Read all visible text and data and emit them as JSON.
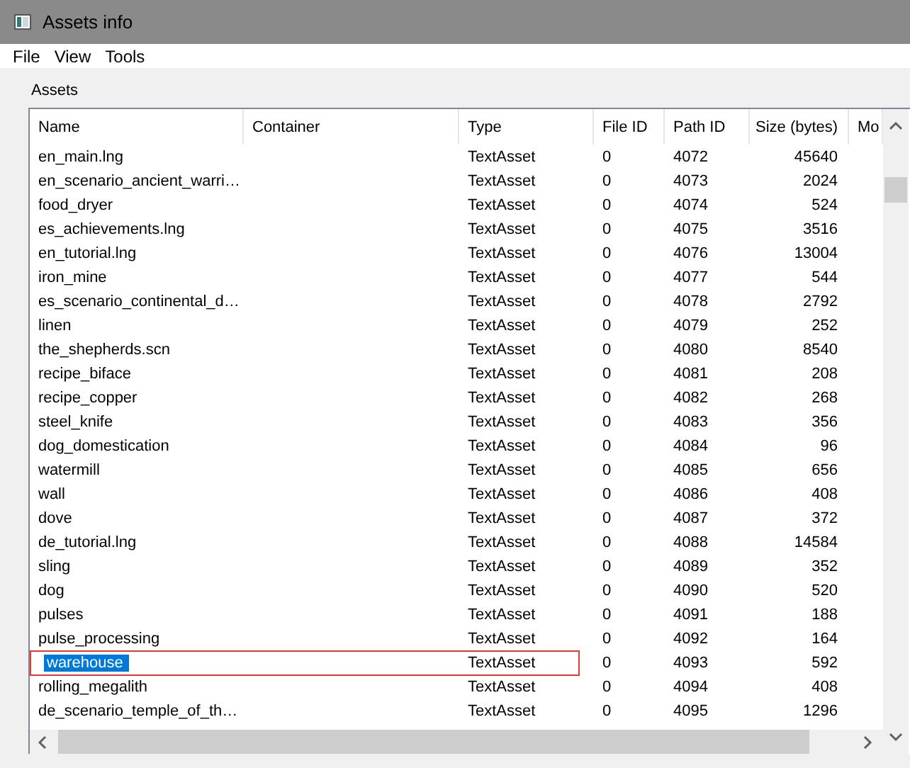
{
  "window": {
    "title": "Assets info"
  },
  "menu": [
    "File",
    "View",
    "Tools"
  ],
  "group_label": "Assets",
  "table": {
    "columns": [
      "Name",
      "Container",
      "Type",
      "File ID",
      "Path ID",
      "Size (bytes)",
      "Mo"
    ],
    "rows": [
      {
        "name": "en_main.lng",
        "type": "TextAsset",
        "file_id": "0",
        "path_id": "4072",
        "size": "45640",
        "selected": false,
        "outlined": false
      },
      {
        "name": "en_scenario_ancient_warri…",
        "type": "TextAsset",
        "file_id": "0",
        "path_id": "4073",
        "size": "2024",
        "selected": false,
        "outlined": false
      },
      {
        "name": "food_dryer",
        "type": "TextAsset",
        "file_id": "0",
        "path_id": "4074",
        "size": "524",
        "selected": false,
        "outlined": false
      },
      {
        "name": "es_achievements.lng",
        "type": "TextAsset",
        "file_id": "0",
        "path_id": "4075",
        "size": "3516",
        "selected": false,
        "outlined": false
      },
      {
        "name": "en_tutorial.lng",
        "type": "TextAsset",
        "file_id": "0",
        "path_id": "4076",
        "size": "13004",
        "selected": false,
        "outlined": false
      },
      {
        "name": "iron_mine",
        "type": "TextAsset",
        "file_id": "0",
        "path_id": "4077",
        "size": "544",
        "selected": false,
        "outlined": false
      },
      {
        "name": "es_scenario_continental_d…",
        "type": "TextAsset",
        "file_id": "0",
        "path_id": "4078",
        "size": "2792",
        "selected": false,
        "outlined": false
      },
      {
        "name": "linen",
        "type": "TextAsset",
        "file_id": "0",
        "path_id": "4079",
        "size": "252",
        "selected": false,
        "outlined": false
      },
      {
        "name": "the_shepherds.scn",
        "type": "TextAsset",
        "file_id": "0",
        "path_id": "4080",
        "size": "8540",
        "selected": false,
        "outlined": false
      },
      {
        "name": "recipe_biface",
        "type": "TextAsset",
        "file_id": "0",
        "path_id": "4081",
        "size": "208",
        "selected": false,
        "outlined": false
      },
      {
        "name": "recipe_copper",
        "type": "TextAsset",
        "file_id": "0",
        "path_id": "4082",
        "size": "268",
        "selected": false,
        "outlined": false
      },
      {
        "name": "steel_knife",
        "type": "TextAsset",
        "file_id": "0",
        "path_id": "4083",
        "size": "356",
        "selected": false,
        "outlined": false
      },
      {
        "name": "dog_domestication",
        "type": "TextAsset",
        "file_id": "0",
        "path_id": "4084",
        "size": "96",
        "selected": false,
        "outlined": false
      },
      {
        "name": "watermill",
        "type": "TextAsset",
        "file_id": "0",
        "path_id": "4085",
        "size": "656",
        "selected": false,
        "outlined": false
      },
      {
        "name": "wall",
        "type": "TextAsset",
        "file_id": "0",
        "path_id": "4086",
        "size": "408",
        "selected": false,
        "outlined": false
      },
      {
        "name": "dove",
        "type": "TextAsset",
        "file_id": "0",
        "path_id": "4087",
        "size": "372",
        "selected": false,
        "outlined": false
      },
      {
        "name": "de_tutorial.lng",
        "type": "TextAsset",
        "file_id": "0",
        "path_id": "4088",
        "size": "14584",
        "selected": false,
        "outlined": false
      },
      {
        "name": "sling",
        "type": "TextAsset",
        "file_id": "0",
        "path_id": "4089",
        "size": "352",
        "selected": false,
        "outlined": false
      },
      {
        "name": "dog",
        "type": "TextAsset",
        "file_id": "0",
        "path_id": "4090",
        "size": "520",
        "selected": false,
        "outlined": false
      },
      {
        "name": "pulses",
        "type": "TextAsset",
        "file_id": "0",
        "path_id": "4091",
        "size": "188",
        "selected": false,
        "outlined": false
      },
      {
        "name": "pulse_processing",
        "type": "TextAsset",
        "file_id": "0",
        "path_id": "4092",
        "size": "164",
        "selected": false,
        "outlined": false
      },
      {
        "name": "warehouse",
        "type": "TextAsset",
        "file_id": "0",
        "path_id": "4093",
        "size": "592",
        "selected": true,
        "outlined": true
      },
      {
        "name": "rolling_megalith",
        "type": "TextAsset",
        "file_id": "0",
        "path_id": "4094",
        "size": "408",
        "selected": false,
        "outlined": false
      },
      {
        "name": "de_scenario_temple_of_th…",
        "type": "TextAsset",
        "file_id": "0",
        "path_id": "4095",
        "size": "1296",
        "selected": false,
        "outlined": false
      }
    ]
  }
}
